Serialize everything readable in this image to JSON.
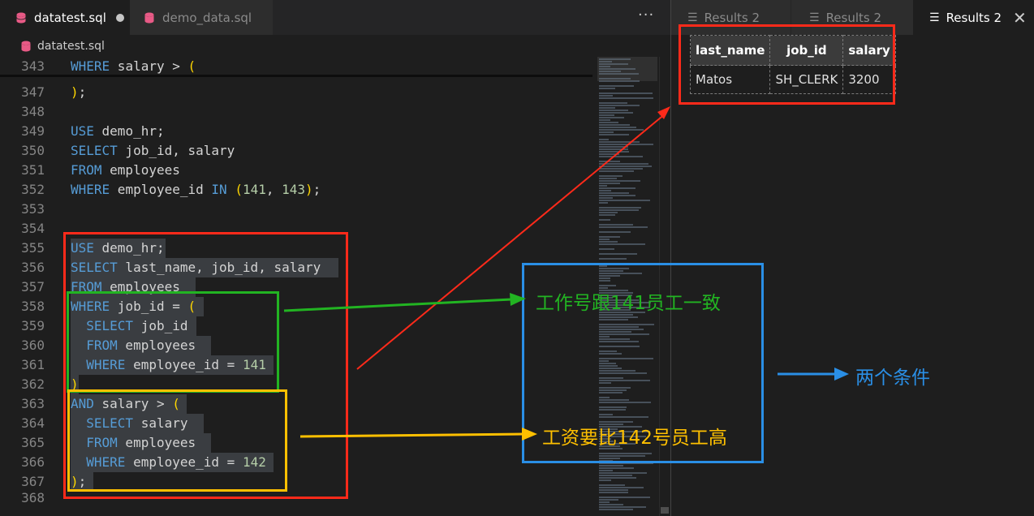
{
  "editor_tabs": [
    {
      "label": "datatest.sql",
      "modified": true,
      "active": true
    },
    {
      "label": "demo_data.sql",
      "modified": false,
      "active": false
    }
  ],
  "more_label": "···",
  "breadcrumb": "datatest.sql",
  "lines": [
    {
      "n": "343",
      "t": [
        {
          "c": "kw",
          "v": "WHERE"
        },
        {
          "c": "id",
          "v": " salary > "
        },
        {
          "c": "par",
          "v": "("
        }
      ]
    },
    {
      "n": "347",
      "t": [
        {
          "c": "par",
          "v": ")"
        },
        {
          "c": "id",
          "v": ";"
        }
      ]
    },
    {
      "n": "348",
      "t": []
    },
    {
      "n": "349",
      "t": [
        {
          "c": "kw",
          "v": "USE"
        },
        {
          "c": "id",
          "v": " demo_hr;"
        }
      ]
    },
    {
      "n": "350",
      "t": [
        {
          "c": "kw",
          "v": "SELECT"
        },
        {
          "c": "id",
          "v": " job_id, salary"
        }
      ]
    },
    {
      "n": "351",
      "t": [
        {
          "c": "kw",
          "v": "FROM"
        },
        {
          "c": "id",
          "v": " employees"
        }
      ]
    },
    {
      "n": "352",
      "t": [
        {
          "c": "kw",
          "v": "WHERE"
        },
        {
          "c": "id",
          "v": " employee_id "
        },
        {
          "c": "kw",
          "v": "IN"
        },
        {
          "c": "id",
          "v": " "
        },
        {
          "c": "par",
          "v": "("
        },
        {
          "c": "num",
          "v": "141"
        },
        {
          "c": "id",
          "v": ", "
        },
        {
          "c": "num",
          "v": "143"
        },
        {
          "c": "par",
          "v": ")"
        },
        {
          "c": "id",
          "v": ";"
        }
      ]
    },
    {
      "n": "353",
      "t": []
    },
    {
      "n": "354",
      "t": []
    },
    {
      "n": "355",
      "hl": 117,
      "t": [
        {
          "c": "kw",
          "v": "USE"
        },
        {
          "c": "id",
          "v": " demo_hr;"
        }
      ]
    },
    {
      "n": "356",
      "hl": 330,
      "t": [
        {
          "c": "kw",
          "v": "SELECT"
        },
        {
          "c": "id",
          "v": " last_name, job_id, salary"
        }
      ]
    },
    {
      "n": "357",
      "hl": 154,
      "t": [
        {
          "c": "kw",
          "v": "FROM"
        },
        {
          "c": "id",
          "v": " employees"
        }
      ]
    },
    {
      "n": "358",
      "hl": 164,
      "t": [
        {
          "c": "kw",
          "v": "WHERE"
        },
        {
          "c": "id",
          "v": " job_id = "
        },
        {
          "c": "par",
          "v": "("
        }
      ]
    },
    {
      "n": "359",
      "hl": 155,
      "t": [
        {
          "c": "id",
          "v": "  "
        },
        {
          "c": "kw",
          "v": "SELECT"
        },
        {
          "c": "id",
          "v": " job_id"
        }
      ]
    },
    {
      "n": "360",
      "hl": 173,
      "t": [
        {
          "c": "id",
          "v": "  "
        },
        {
          "c": "kw",
          "v": "FROM"
        },
        {
          "c": "id",
          "v": " employees"
        }
      ]
    },
    {
      "n": "361",
      "hl": 250,
      "t": [
        {
          "c": "id",
          "v": "  "
        },
        {
          "c": "kw",
          "v": "WHERE"
        },
        {
          "c": "id",
          "v": " employee_id = "
        },
        {
          "c": "num",
          "v": "141"
        }
      ]
    },
    {
      "n": "362",
      "hl": 10,
      "t": [
        {
          "c": "par",
          "v": ")"
        }
      ]
    },
    {
      "n": "363",
      "hl": 143,
      "t": [
        {
          "c": "kw",
          "v": "AND"
        },
        {
          "c": "id",
          "v": " salary > "
        },
        {
          "c": "par",
          "v": "("
        }
      ]
    },
    {
      "n": "364",
      "hl": 164,
      "t": [
        {
          "c": "id",
          "v": "  "
        },
        {
          "c": "kw",
          "v": "SELECT"
        },
        {
          "c": "id",
          "v": " salary"
        }
      ]
    },
    {
      "n": "365",
      "hl": 173,
      "t": [
        {
          "c": "id",
          "v": "  "
        },
        {
          "c": "kw",
          "v": "FROM"
        },
        {
          "c": "id",
          "v": " employees"
        }
      ]
    },
    {
      "n": "366",
      "hl": 250,
      "t": [
        {
          "c": "id",
          "v": "  "
        },
        {
          "c": "kw",
          "v": "WHERE"
        },
        {
          "c": "id",
          "v": " employee_id = "
        },
        {
          "c": "num",
          "v": "142"
        }
      ]
    },
    {
      "n": "367",
      "hl": 28,
      "t": [
        {
          "c": "par",
          "v": ")"
        },
        {
          "c": "id",
          "v": ";"
        }
      ]
    },
    {
      "n": "368",
      "t": []
    }
  ],
  "results_tabs": [
    {
      "label": "Results 2",
      "active": false
    },
    {
      "label": "Results 2",
      "active": false
    },
    {
      "label": "Results 2",
      "active": true
    }
  ],
  "results": {
    "columns": [
      "last_name",
      "job_id",
      "salary"
    ],
    "rows": [
      [
        "Matos",
        "SH_CLERK",
        "3200"
      ]
    ]
  },
  "annotations": {
    "green_text": "工作号跟141员工一致",
    "yellow_text": "工资要比142号员工高",
    "blue_text": "两个条件"
  },
  "colors": {
    "red": "#ff2a1a",
    "green": "#22b422",
    "yellow": "#ffc000",
    "blue": "#2a8fe6",
    "keyword": "#569cd6",
    "number": "#b5cea8",
    "paren": "#ffd700"
  }
}
